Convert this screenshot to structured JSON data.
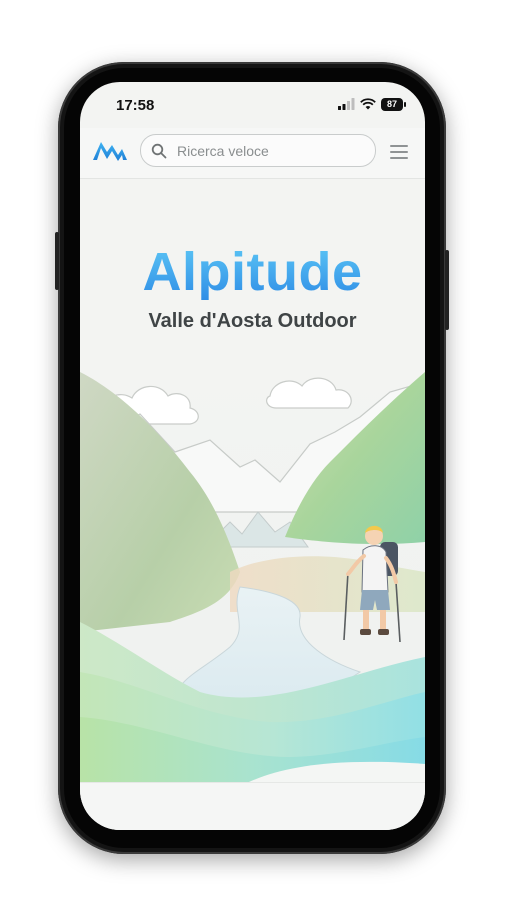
{
  "status_bar": {
    "time": "17:58",
    "battery": "87"
  },
  "header": {
    "logo_icon": "mountain-logo-icon",
    "search": {
      "placeholder": "Ricerca veloce",
      "value": ""
    },
    "menu_icon": "hamburger-menu-icon"
  },
  "hero": {
    "title": "Alpitude",
    "subtitle": "Valle d'Aosta Outdoor"
  },
  "colors": {
    "title_gradient_top": "#5cc6f5",
    "title_gradient_bottom": "#2f8ee6",
    "logo_blue": "#2f9ae6",
    "screen_background": "#f3f4f2"
  }
}
